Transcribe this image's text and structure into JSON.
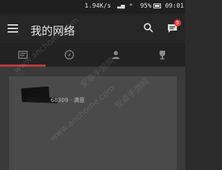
{
  "status_bar": {
    "net_speed": "1.94K/s",
    "battery": "95%",
    "time": "09:01"
  },
  "toolbar": {
    "title": "我的网络",
    "badge_count": "5"
  },
  "tabs": [
    {
      "name": "tab-1"
    },
    {
      "name": "tab-2"
    },
    {
      "name": "tab-3"
    },
    {
      "name": "tab-4"
    }
  ],
  "card": {
    "text": "68309 · 满意"
  },
  "watermark": {
    "text1": "www.anchome.com",
    "text2": "安卓手游网"
  },
  "colors": {
    "accent": "#c23b3b",
    "badge": "#e53935"
  }
}
